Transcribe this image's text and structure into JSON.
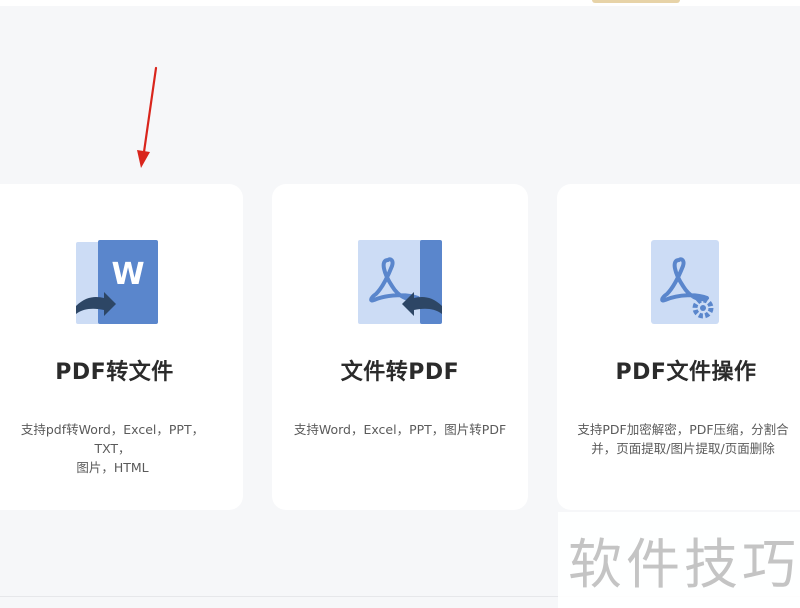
{
  "cards": [
    {
      "title": "PDF转文件",
      "desc_line1": "支持pdf转Word，Excel，PPT，TXT，",
      "desc_line2": "图片，HTML",
      "icon": "pdf-to-word-icon"
    },
    {
      "title": "文件转PDF",
      "desc_line1": "支持Word，Excel，PPT，图片转PDF",
      "icon": "file-to-pdf-icon"
    },
    {
      "title": "PDF文件操作",
      "desc_line1": "支持PDF加密解密，PDF压缩，分割合",
      "desc_line2": "并，页面提取/图片提取/页面删除",
      "icon": "pdf-operations-icon"
    }
  ],
  "watermark": {
    "text": "软件技巧"
  },
  "colors": {
    "icon_dark": "#5a86cc",
    "icon_light": "#ccdcf5",
    "icon_arrow": "#2d4665",
    "annotation_arrow": "#d9251c",
    "background": "#f6f7f9",
    "card": "#ffffff"
  }
}
